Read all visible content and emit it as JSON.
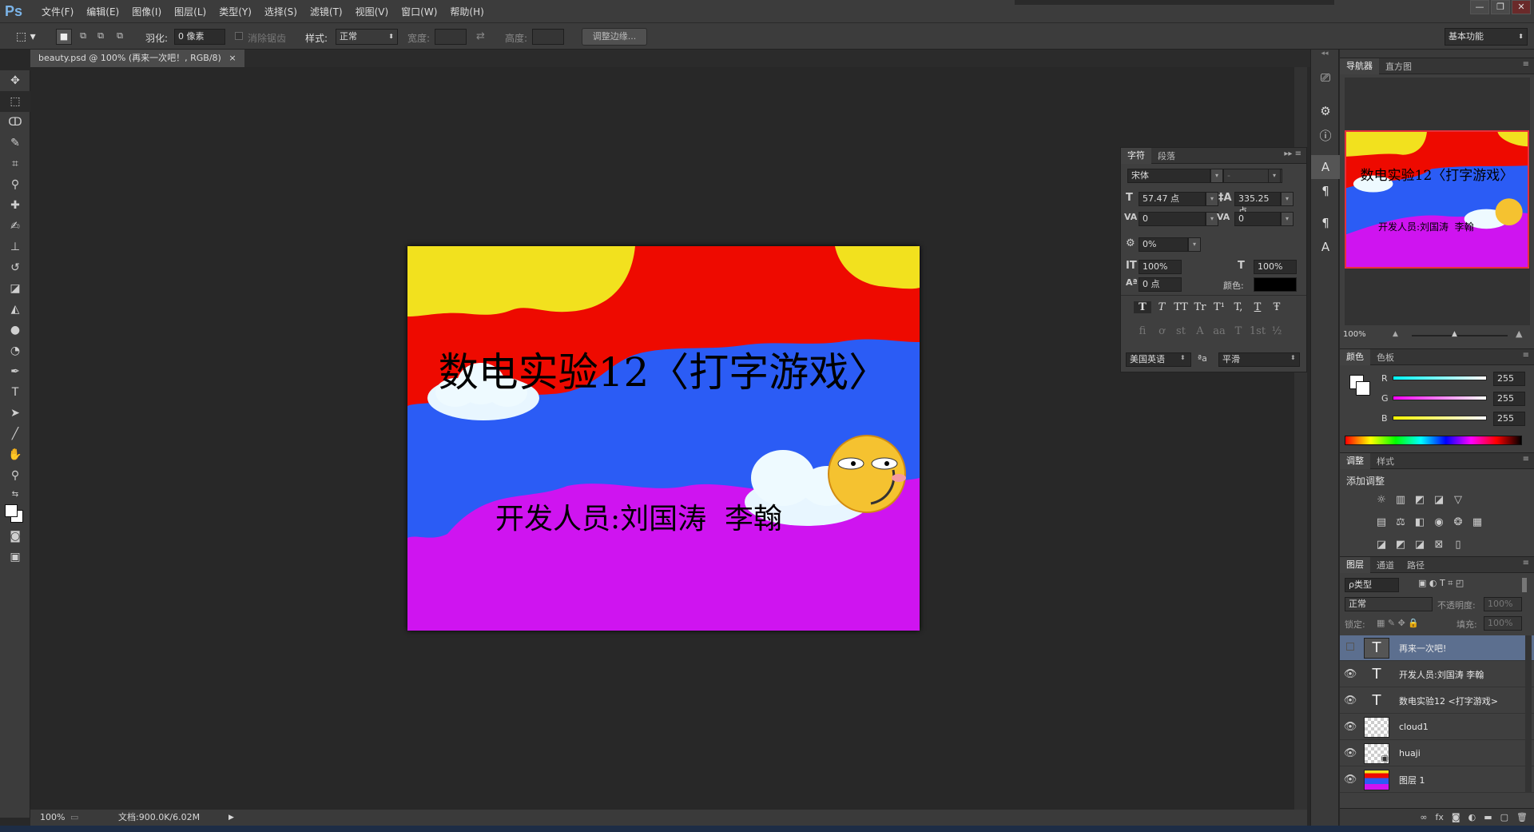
{
  "app": {
    "logo": "Ps"
  },
  "menu": [
    "文件(F)",
    "编辑(E)",
    "图像(I)",
    "图层(L)",
    "类型(Y)",
    "选择(S)",
    "滤镜(T)",
    "视图(V)",
    "窗口(W)",
    "帮助(H)"
  ],
  "window_controls": {
    "minimize": "—",
    "restore": "❐",
    "close": "✕"
  },
  "options_bar": {
    "feather_label": "羽化:",
    "feather_value": "0 像素",
    "antialias_label": "消除锯齿",
    "style_label": "样式:",
    "style_value": "正常",
    "width_label": "宽度:",
    "height_label": "高度:",
    "refine_button": "调整边缘...",
    "workspace": "基本功能"
  },
  "document": {
    "tab_title": "beauty.psd @ 100% (再来一次吧！, RGB/8)",
    "close": "×",
    "title_text": "数电实验12〈打字游戏〉",
    "credits_text": "开发人员:刘国涛  李翰"
  },
  "status_bar": {
    "zoom": "100%",
    "doc_info": "文档:900.0K/6.02M"
  },
  "character_panel": {
    "tabs": [
      "字符",
      "段落"
    ],
    "font_family": "宋体",
    "font_style": "-",
    "font_size": "57.47 点",
    "leading": "335.25 点",
    "kerning": "0",
    "tracking": "0",
    "tsume": "0%",
    "vertical_scale": "100%",
    "horizontal_scale": "100%",
    "baseline_shift": "0 点",
    "color_label": "颜色:",
    "color_value": "#000000",
    "style_buttons": [
      "T",
      "T",
      "TT",
      "Tr",
      "T¹",
      "T,",
      "T",
      "Ŧ"
    ],
    "opentype_buttons": [
      "fi",
      "ơ",
      "st",
      "A",
      "aa",
      "T",
      "1st",
      "½"
    ],
    "language": "美国英语",
    "aa_label": "ªa",
    "antialias": "平滑"
  },
  "navigator": {
    "tabs": [
      "导航器",
      "直方图"
    ],
    "zoom": "100%"
  },
  "color_panel": {
    "tabs": [
      "颜色",
      "色板"
    ],
    "channels": [
      {
        "label": "R",
        "value": "255",
        "color": "#ff3b3b"
      },
      {
        "label": "G",
        "value": "255",
        "color": "#3bff3b"
      },
      {
        "label": "B",
        "value": "255",
        "color": "#3b6bff"
      }
    ]
  },
  "adjustments": {
    "tabs": [
      "调整",
      "样式"
    ],
    "heading": "添加调整"
  },
  "layers_panel": {
    "tabs": [
      "图层",
      "通道",
      "路径"
    ],
    "filter": "ρ类型",
    "blend_mode": "正常",
    "opacity_label": "不透明度:",
    "opacity_value": "100%",
    "lock_label": "锁定:",
    "fill_label": "填充:",
    "fill_value": "100%",
    "layers": [
      {
        "name": "再来一次吧!",
        "type": "text",
        "visible": false,
        "selected": true
      },
      {
        "name": "开发人员:刘国涛 李翰",
        "type": "text",
        "visible": true,
        "selected": false
      },
      {
        "name": "数电实验12 <打字游戏>",
        "type": "text",
        "visible": true,
        "selected": false
      },
      {
        "name": "cloud1",
        "type": "raster",
        "visible": true,
        "selected": false
      },
      {
        "name": "huaji",
        "type": "smart",
        "visible": true,
        "selected": false
      },
      {
        "name": "图层 1",
        "type": "raster",
        "visible": true,
        "selected": false
      }
    ],
    "footer_icons": [
      "link-icon",
      "fx-icon",
      "mask-icon",
      "adjustment-icon",
      "folder-icon",
      "new-layer-icon",
      "trash-icon"
    ]
  },
  "colors": {
    "canvas_red": "#ee0a00",
    "canvas_yellow": "#f2e11e",
    "canvas_blue": "#2b5cf5",
    "canvas_magenta": "#cf14f0",
    "selected_layer": "#5c6f8f"
  }
}
